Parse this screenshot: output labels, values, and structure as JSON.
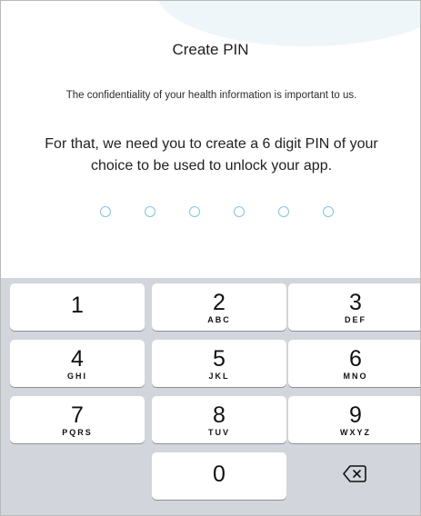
{
  "header": {
    "title": "Create PIN"
  },
  "content": {
    "subtitle": "The confidentiality of your health information is important to us.",
    "description": "For that, we need you to create a 6 digit PIN of your choice to be used to unlock your app."
  },
  "pin": {
    "length": 6,
    "entered": 0,
    "dot_color": "#7cc7e4"
  },
  "keypad": {
    "keys": [
      {
        "digit": "1",
        "letters": ""
      },
      {
        "digit": "2",
        "letters": "ABC"
      },
      {
        "digit": "3",
        "letters": "DEF"
      },
      {
        "digit": "4",
        "letters": "GHI"
      },
      {
        "digit": "5",
        "letters": "JKL"
      },
      {
        "digit": "6",
        "letters": "MNO"
      },
      {
        "digit": "7",
        "letters": "PQRS"
      },
      {
        "digit": "8",
        "letters": "TUV"
      },
      {
        "digit": "9",
        "letters": "WXYZ"
      },
      {
        "digit": "0",
        "letters": ""
      }
    ],
    "backspace_icon": "backspace-icon",
    "background_color": "#d2d5db"
  }
}
